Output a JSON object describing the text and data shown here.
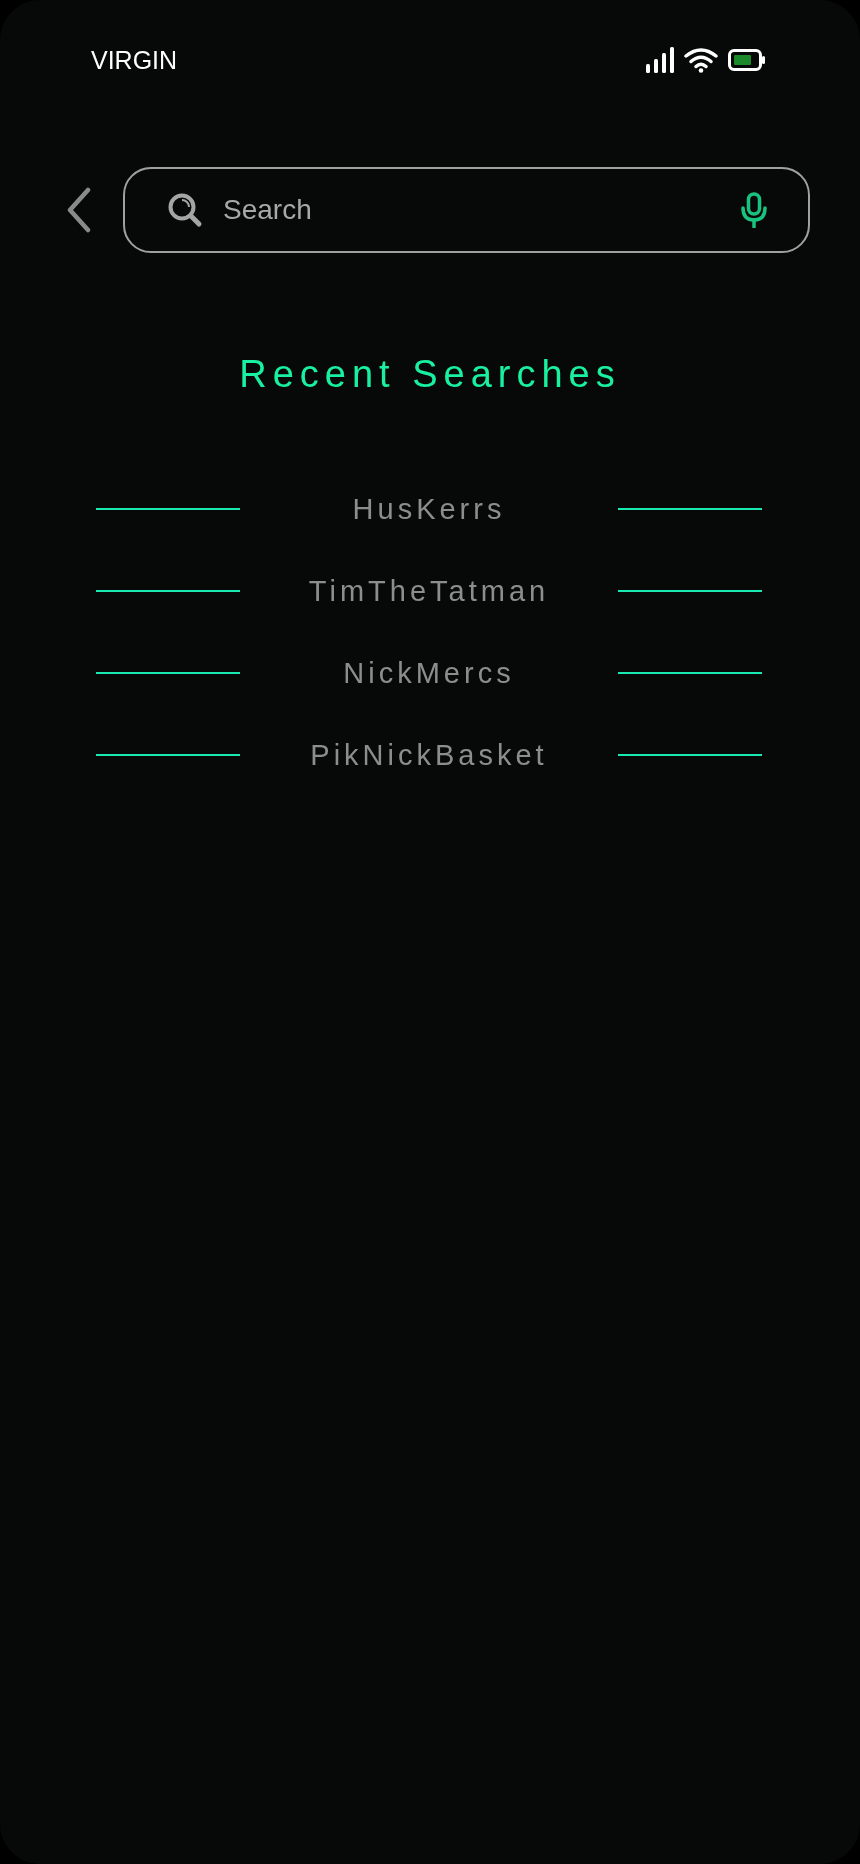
{
  "status_bar": {
    "carrier": "VIRGIN"
  },
  "search": {
    "placeholder": "Search"
  },
  "recent_searches": {
    "title": "Recent Searches",
    "items": [
      {
        "label": "HusKerrs"
      },
      {
        "label": "TimTheTatman"
      },
      {
        "label": "NickMercs"
      },
      {
        "label": "PikNickBasket"
      }
    ]
  }
}
